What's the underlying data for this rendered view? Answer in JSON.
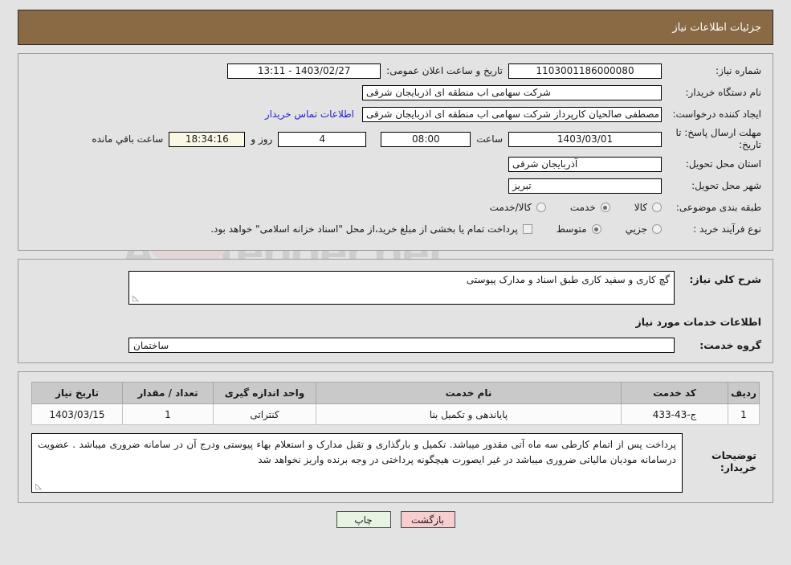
{
  "header": {
    "title": "جزئیات اطلاعات نیاز"
  },
  "watermark": {
    "text": "AriaTender.net"
  },
  "top_form": {
    "need_number_label": "شماره نیاز:",
    "need_number_value": "1103001186000080",
    "announce_label": "تاریخ و ساعت اعلان عمومی:",
    "announce_value": "1403/02/27 - 13:11",
    "buyer_org_label": "نام دستگاه خریدار:",
    "buyer_org_value": "شرکت سهامی اب منطقه ای اذربایجان شرقی",
    "creator_label": "ایجاد کننده درخواست:",
    "creator_value": "مصطفی صالحیان کارپرداز شرکت سهامی اب منطقه ای اذربایجان شرقی",
    "contact_link": "اطلاعات تماس خریدار",
    "deadline_label_line1": "مهلت ارسال پاسخ: تا",
    "deadline_label_line2": "تاریخ:",
    "deadline_date": "1403/03/01",
    "hour_label": "ساعت",
    "hour_value": "08:00",
    "days_value": "4",
    "days_label": "روز و",
    "remaining_value": "18:34:16",
    "remaining_label": "ساعت باقي مانده",
    "province_label": "استان محل تحویل:",
    "province_value": "آذربایجان شرقی",
    "city_label": "شهر محل تحویل:",
    "city_value": "تبریز",
    "category_label": "طبقه بندی موضوعی:",
    "category_options": [
      {
        "label": "کالا",
        "selected": false
      },
      {
        "label": "خدمت",
        "selected": true
      },
      {
        "label": "کالا/خدمت",
        "selected": false
      }
    ],
    "process_label": "نوع فرآیند خرید :",
    "process_options": [
      {
        "label": "جزیي",
        "selected": false
      },
      {
        "label": "متوسط",
        "selected": true
      }
    ],
    "treasury_checkbox_label": "پرداخت تمام یا بخشی از مبلغ خرید،از محل \"اسناد خزانه اسلامی\" خواهد بود.",
    "treasury_checked": false
  },
  "middle": {
    "general_desc_label": "شرح کلي نیاز:",
    "general_desc_value": "گچ کاری و سفید کاری طبق اسناد و مدارک پیوستی",
    "services_section_title": "اطلاعات خدمات مورد نیاز",
    "service_group_label": "گروه خدمت:",
    "service_group_value": "ساختمان"
  },
  "items_table": {
    "columns": [
      "ردیف",
      "کد خدمت",
      "نام خدمت",
      "واحد اندازه گیری",
      "تعداد / مقدار",
      "تاریخ نیاز"
    ],
    "rows": [
      {
        "radif": "1",
        "code": "ج-43-433",
        "name": "پایاندهی و تکمیل بنا",
        "unit": "کنتراتی",
        "qty": "1",
        "date": "1403/03/15"
      }
    ]
  },
  "buyer_notes": {
    "label": "توضیحات خریدار:",
    "value": "پرداخت پس از اتمام کارطی سه ماه آتی مقدور میباشد. تکمیل و بارگذاری و تقبل مدارک و استعلام بهاء پیوستی ودرج آن در سامانه ضروری میباشد . عضویت درسامانه مودیان مالیاتی ضروری میباشد در غیر ایصورت هیچگونه پرداختی در وجه برنده واریز نخواهد شد"
  },
  "footer": {
    "back_label": "بازگشت",
    "print_label": "چاپ"
  }
}
